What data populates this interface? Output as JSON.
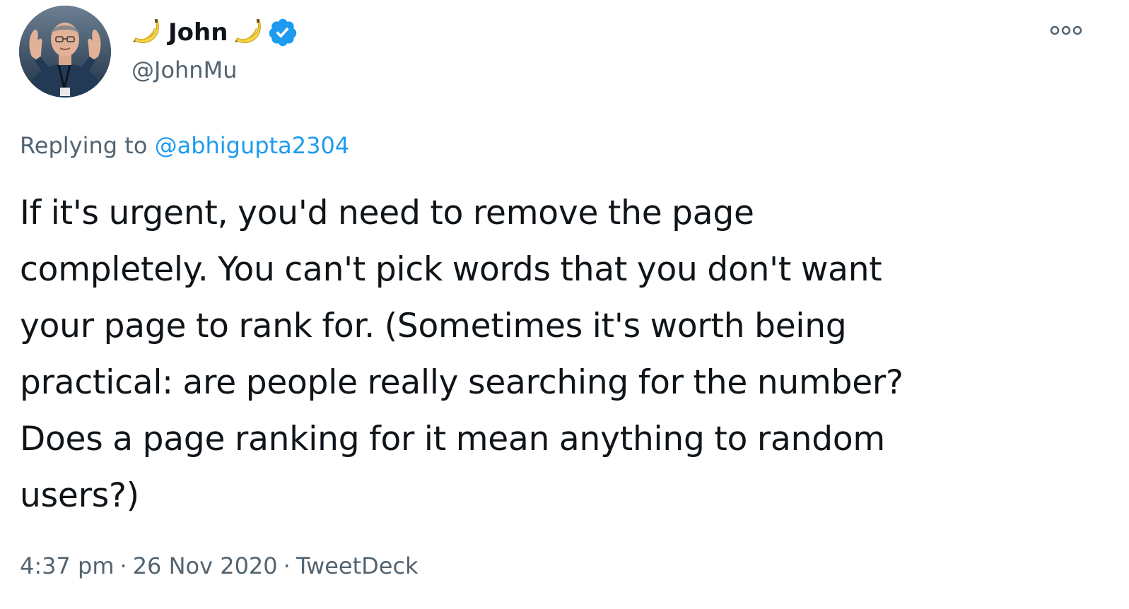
{
  "author": {
    "display_name": "John",
    "handle": "@JohnMu",
    "name_emoji": "banana-icon",
    "verified": true,
    "verified_color": "#1d9bf0"
  },
  "reply": {
    "prefix": "Replying to",
    "mention": "@abhigupta2304"
  },
  "tweet": {
    "lines": [
      "If it's urgent, you'd need to remove the page",
      "completely. You can't pick words that you don't want",
      "your page to rank for. (Sometimes it's worth being",
      "practical: are people really searching for the number?",
      "Does a page ranking for it mean anything to random",
      "users?)"
    ]
  },
  "meta": {
    "time": "4:37 pm",
    "separator": "·",
    "date": "26 Nov 2020",
    "source": "TweetDeck"
  },
  "colors": {
    "text": "#0f1419",
    "secondary": "#536471",
    "link": "#1d9bf0"
  }
}
